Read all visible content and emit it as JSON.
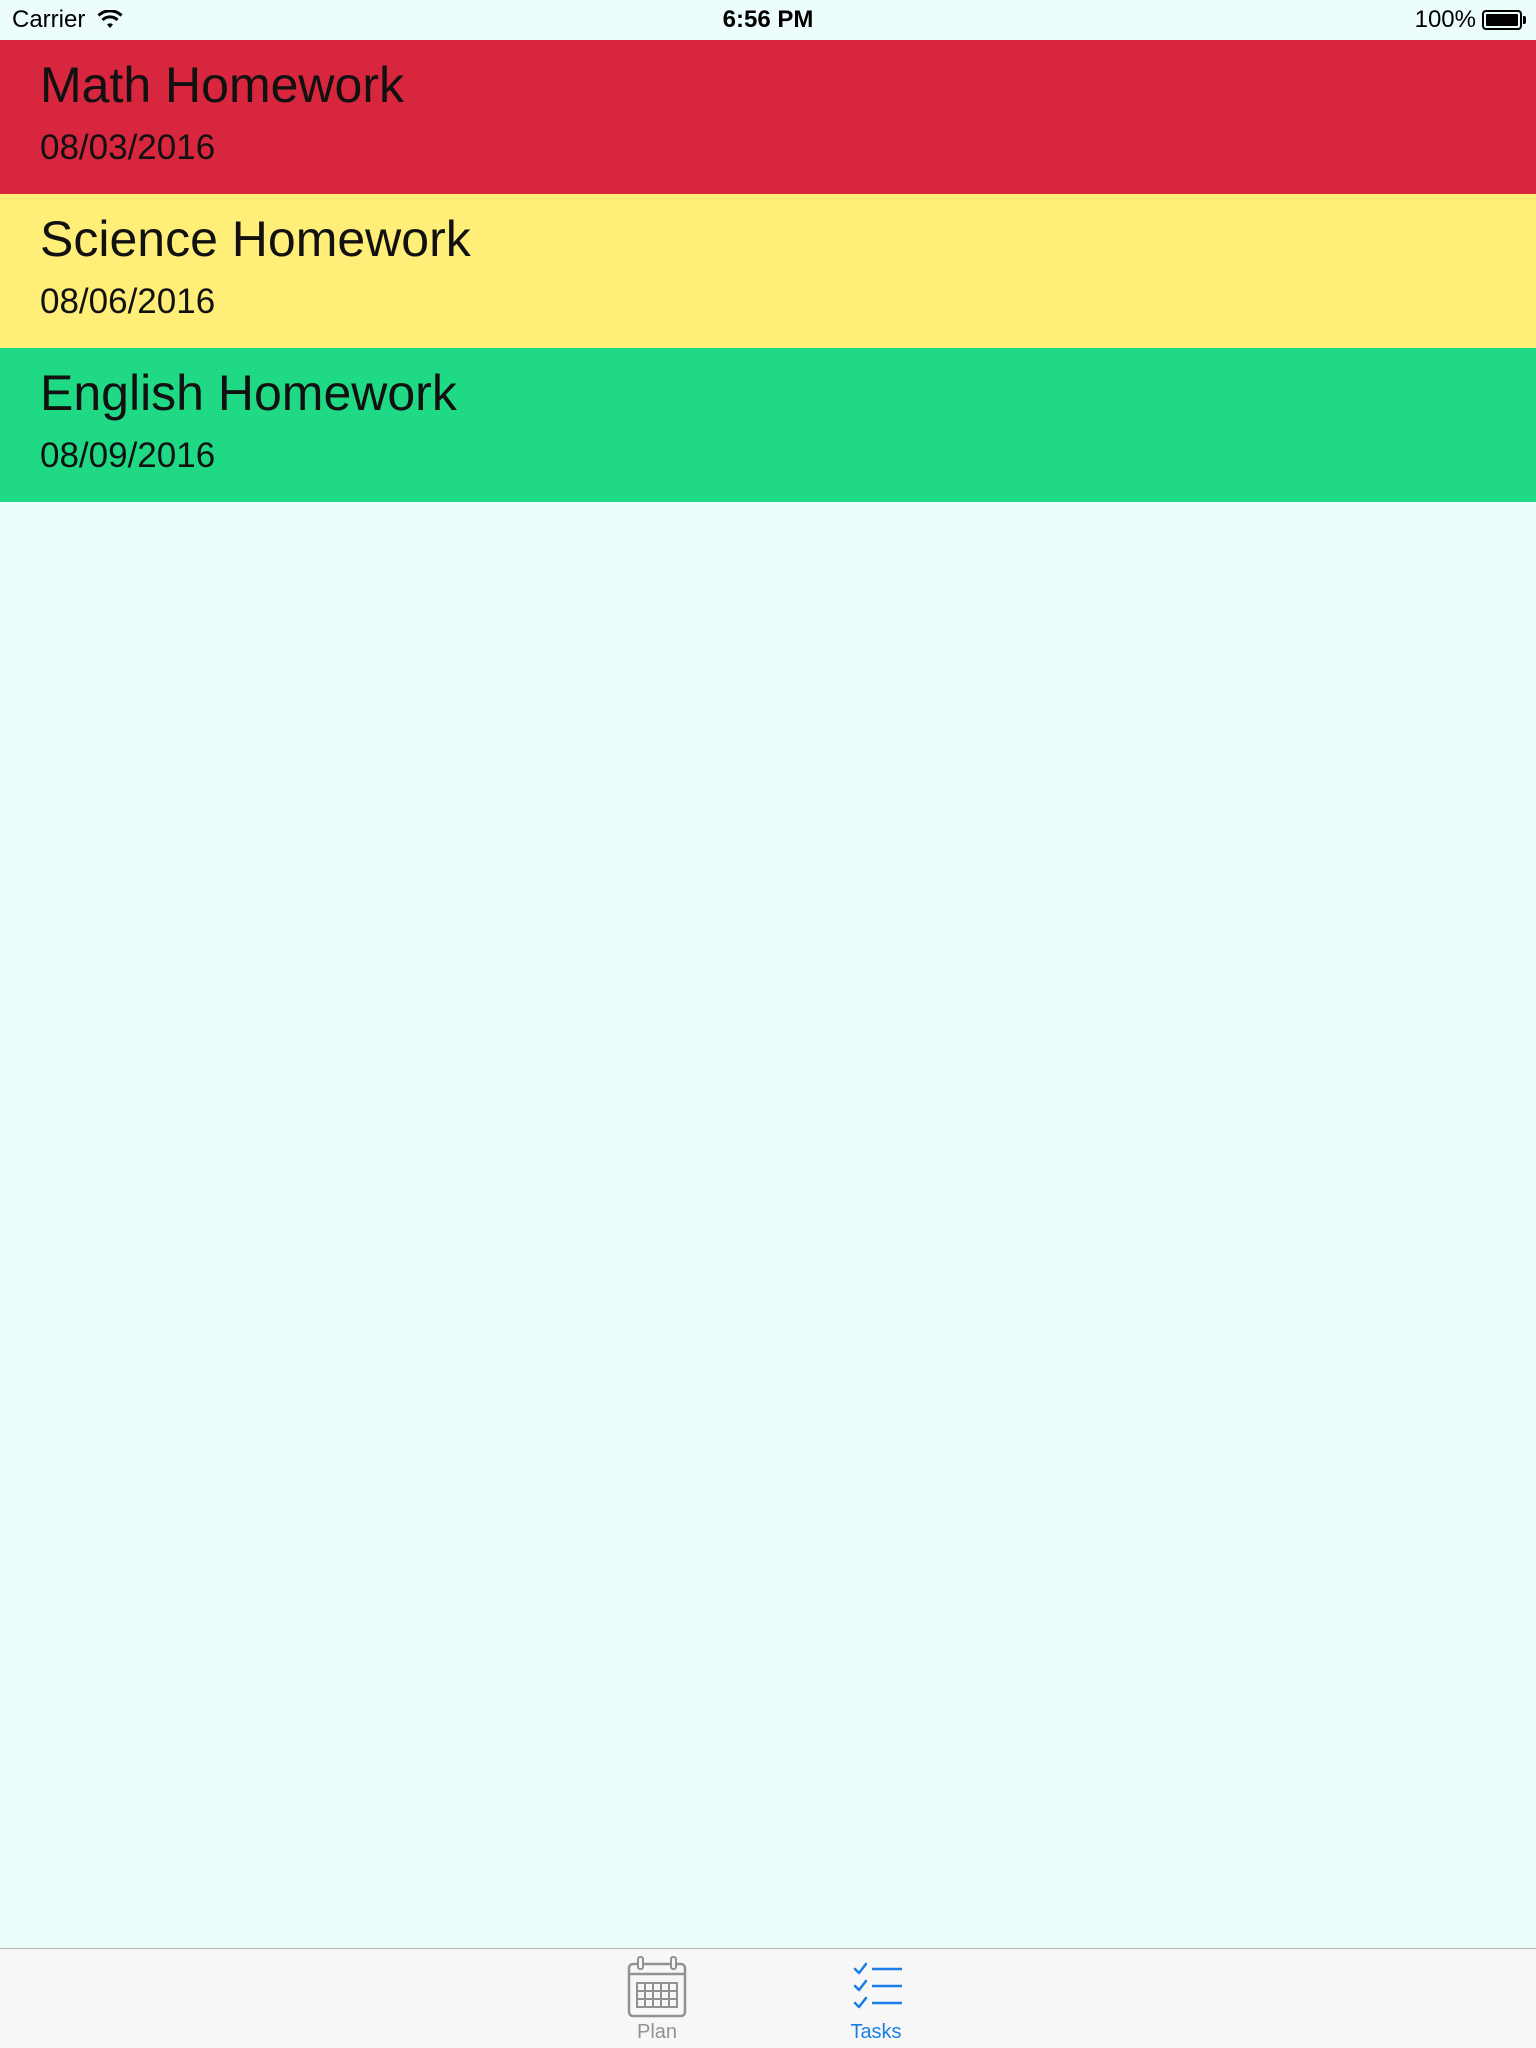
{
  "status_bar": {
    "carrier": "Carrier",
    "time": "6:56 PM",
    "battery": "100%",
    "battery_level": 1.0
  },
  "tasks": [
    {
      "title": "Math Homework",
      "date": "08/03/2016",
      "color": "#d7263d"
    },
    {
      "title": "Science Homework",
      "date": "08/06/2016",
      "color": "#ffee78"
    },
    {
      "title": "English Homework",
      "date": "08/09/2016",
      "color": "#1fd985"
    }
  ],
  "tab_bar": {
    "tabs": [
      {
        "label": "Plan",
        "icon": "calendar-icon",
        "selected": false,
        "color": "#929292"
      },
      {
        "label": "Tasks",
        "icon": "checklist-icon",
        "selected": true,
        "color": "#1a7ee6"
      }
    ]
  },
  "colors": {
    "background": "#ecfdfb",
    "tab_bar_background": "#f7f7f7",
    "accent": "#1a7ee6"
  }
}
